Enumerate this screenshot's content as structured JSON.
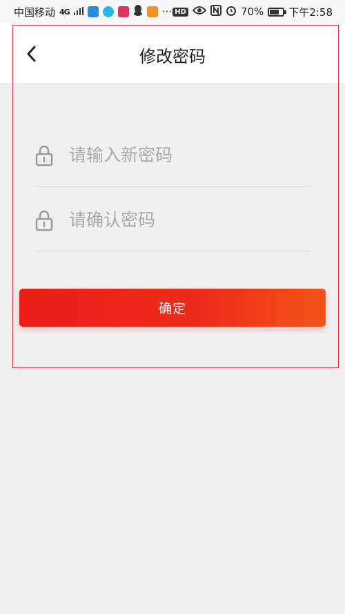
{
  "status_bar": {
    "carrier": "中国移动",
    "network": "4G",
    "more": "···",
    "hd": "HD",
    "battery": "70%",
    "battery_level": 0.7,
    "time": "下午2:58"
  },
  "header": {
    "title": "修改密码",
    "back_icon": "chevron-left-icon"
  },
  "form": {
    "new_password": {
      "placeholder": "请输入新密码",
      "value": "",
      "icon": "lock-icon"
    },
    "confirm_password": {
      "placeholder": "请确认密码",
      "value": "",
      "icon": "lock-icon"
    }
  },
  "actions": {
    "confirm_label": "确定"
  },
  "colors": {
    "accent_start": "#ea1d16",
    "accent_end": "#f35417",
    "frame": "#e23a3a"
  }
}
